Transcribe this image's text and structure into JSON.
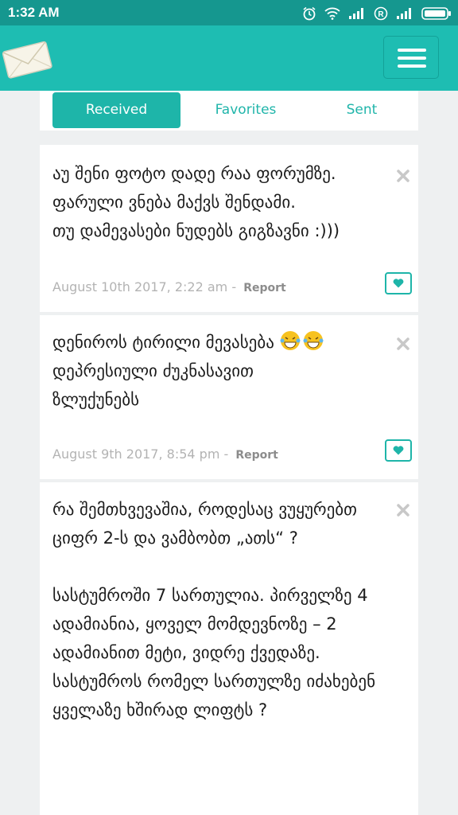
{
  "status_bar": {
    "time": "1:32 AM"
  },
  "app": {
    "accent": "#1ebdb2",
    "status_color": "#15978f",
    "logo_icon": "envelope-icon",
    "menu_icon": "hamburger-icon"
  },
  "tabs": [
    {
      "label": "Received",
      "active": true
    },
    {
      "label": "Favorites",
      "active": false
    },
    {
      "label": "Sent",
      "active": false
    }
  ],
  "messages": [
    {
      "text": "აუ შენი ფოტო დადე რაა ფორუმზე.\nფარული ვნება მაქვს შენდამი.\nთუ დამევასები ნუდებს გიგზავნი :)))",
      "date": "August 10th 2017, 2:22 am",
      "separator": " - ",
      "report": "Report"
    },
    {
      "text_before": "დენიროს ტირილი მევასება ",
      "text_after": "\nდეპრესიული ძუკნასავით\nზლუქუნებს",
      "emoji": "grinning-tears-emoji",
      "date": "August 9th 2017, 8:54 pm",
      "separator": " - ",
      "report": "Report"
    },
    {
      "text": "რა შემთხვევაშია, როდესაც ვუყურებთ ციფრ 2-ს და ვამბობთ „ათს“ ?\n\nსასტუმროში 7 სართულია. პირველზე 4 ადამიანია, ყოველ მომდევნოზე – 2 ადამიანით მეტი, ვიდრე ქვედაზე. სასტუმროს რომელ სართულზე იძახებენ ყველაზე ხშირად ლიფტს ?"
    }
  ]
}
